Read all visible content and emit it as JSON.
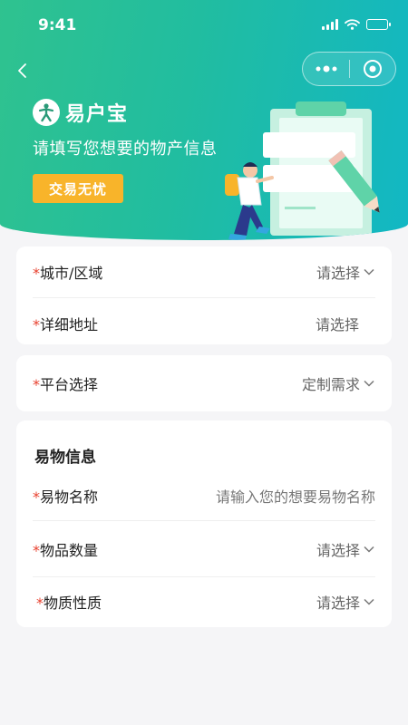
{
  "status": {
    "time": "9:41"
  },
  "nav": {
    "back_icon": "chevron-left-icon",
    "more_icon": "more-dots-icon",
    "target_icon": "target-icon"
  },
  "hero": {
    "brand_name": "易户宝",
    "subtitle": "请填写您想要的物产信息",
    "badge": "交易无忧"
  },
  "location_card": {
    "rows": [
      {
        "required": "*",
        "label": "城市/区域",
        "value": "请选择"
      },
      {
        "required": "*",
        "label": "详细地址",
        "value": "请选择"
      }
    ]
  },
  "platform_card": {
    "rows": [
      {
        "required": "*",
        "label": "平台选择",
        "value": "定制需求"
      }
    ]
  },
  "item_card": {
    "title": "易物信息",
    "rows": [
      {
        "required": "*",
        "label": "易物名称",
        "placeholder": "请输入您的想要易物名称"
      },
      {
        "required": "*",
        "label": "物品数量",
        "value": "请选择"
      },
      {
        "required": "*",
        "label": "物质性质",
        "value": "请选择"
      }
    ]
  },
  "colors": {
    "brand_green": "#2fc28f",
    "brand_teal": "#12b7c4",
    "badge_orange": "#f8b42a",
    "required_red": "#e8402e"
  }
}
